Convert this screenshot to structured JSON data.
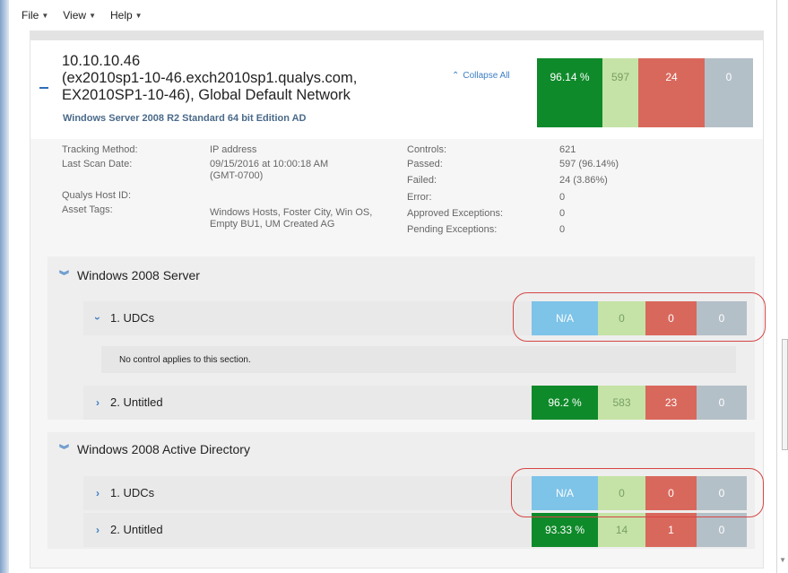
{
  "menubar": {
    "items": [
      {
        "label": "File"
      },
      {
        "label": "View"
      },
      {
        "label": "Help"
      }
    ]
  },
  "host": {
    "title_lines": [
      "10.10.10.46",
      "(ex2010sp1-10-46.exch2010sp1.qualys.com,",
      "EX2010SP1-10-46), Global Default Network"
    ],
    "os": "Windows Server 2008 R2 Standard 64 bit Edition AD",
    "collapse_all_label": "Collapse All",
    "stats": {
      "percent": "96.14 %",
      "passed": "597",
      "failed": "24",
      "error": "0"
    }
  },
  "details": {
    "left": [
      {
        "label": "Tracking Method:",
        "value": "IP address"
      },
      {
        "label": "Last Scan Date:",
        "value": "09/15/2016 at 10:00:18 AM",
        "value2": "(GMT-0700)"
      },
      {
        "label": "Qualys Host ID:",
        "value": ""
      },
      {
        "label": "Asset Tags:",
        "value": "Windows Hosts, Foster City, Win OS,",
        "value2": "Empty BU1, UM Created AG"
      }
    ],
    "right": [
      {
        "label": "Controls:",
        "value": "621"
      },
      {
        "label": "Passed:",
        "value": "597 (96.14%)"
      },
      {
        "label": "Failed:",
        "value": "24 (3.86%)"
      },
      {
        "label": "Error:",
        "value": "0"
      },
      {
        "label": "Approved Exceptions:",
        "value": "0"
      },
      {
        "label": "Pending Exceptions:",
        "value": "0"
      }
    ]
  },
  "sections": [
    {
      "title": "Windows 2008 Server",
      "rows": [
        {
          "number": "1.",
          "label": "UDCs",
          "stat1": "N/A",
          "passed": "0",
          "failed": "0",
          "error": "0",
          "expanded": true,
          "note": "No control applies to this section."
        },
        {
          "number": "2.",
          "label": "Untitled",
          "stat1": "96.2 %",
          "passed": "583",
          "failed": "23",
          "error": "0",
          "expanded": false
        }
      ]
    },
    {
      "title": "Windows 2008 Active Directory",
      "rows": [
        {
          "number": "1.",
          "label": "UDCs",
          "stat1": "N/A",
          "passed": "0",
          "failed": "0",
          "error": "0",
          "expanded": false
        },
        {
          "number": "2.",
          "label": "Untitled",
          "stat1": "93.33 %",
          "passed": "14",
          "failed": "1",
          "error": "0",
          "expanded": false
        }
      ]
    }
  ],
  "colors": {
    "percent_green": "#0f8a2a",
    "passed_light_green": "#c5e3a6",
    "failed_red": "#d9685c",
    "error_gray": "#b4c0c8",
    "na_blue": "#7ec3e8",
    "annotation_red": "#d64545"
  }
}
